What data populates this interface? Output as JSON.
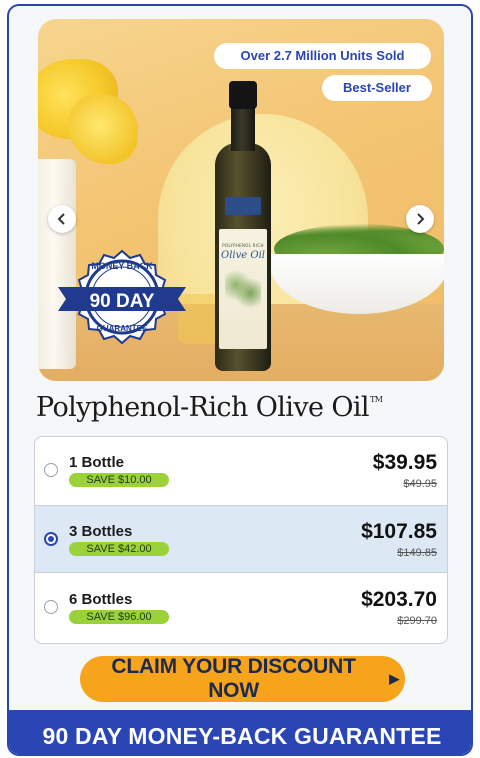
{
  "hero": {
    "units_sold": "Over 2.7 Million Units Sold",
    "best_seller": "Best-Seller",
    "bottle_label_top": "POLYPHENOL RICH",
    "bottle_label_name": "Olive Oil",
    "badge_top": "MONEY BACK",
    "badge_main": "90 DAY",
    "badge_bottom": "GUARANTEE",
    "prev_icon": "chevron-left-icon",
    "next_icon": "chevron-right-icon"
  },
  "product": {
    "title": "Polyphenol-Rich Olive Oil",
    "trademark": "TM"
  },
  "options": [
    {
      "label": "1 Bottle",
      "save": "SAVE $10.00",
      "price": "$39.95",
      "was": "$49.95",
      "selected": false
    },
    {
      "label": "3 Bottles",
      "save": "SAVE $42.00",
      "price": "$107.85",
      "was": "$149.85",
      "selected": true
    },
    {
      "label": "6 Bottles",
      "save": "SAVE $96.00",
      "price": "$203.70",
      "was": "$299.70",
      "selected": false
    }
  ],
  "cta": {
    "label": "CLAIM YOUR DISCOUNT NOW",
    "icon": "play-triangle-icon"
  },
  "footer": {
    "text": "90 DAY MONEY-BACK GUARANTEE"
  },
  "colors": {
    "brand_blue": "#2a46b4",
    "cta_orange": "#f7a41d",
    "save_green": "#9bd23a",
    "selected_row": "#dce9f5"
  }
}
